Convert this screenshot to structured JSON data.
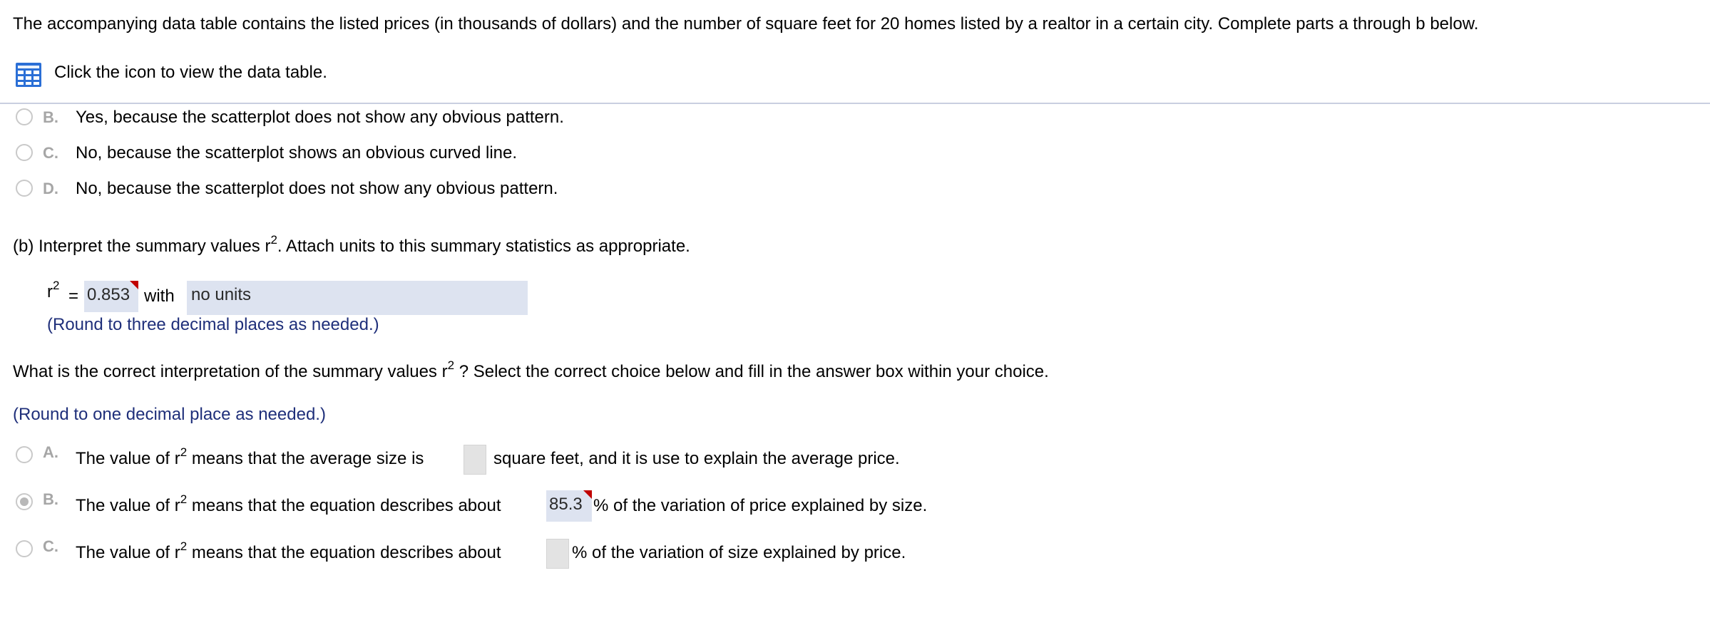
{
  "intro": "The accompanying data table contains the listed prices (in thousands of dollars) and the number of square feet for 20 homes listed by a realtor in a certain city. Complete parts a through b below.",
  "data_table_link": {
    "icon": "table-icon",
    "text": "Click the icon to view the data table."
  },
  "part_a_options": [
    {
      "letter": "B.",
      "text": "Yes, because the scatterplot does not show any obvious pattern."
    },
    {
      "letter": "C.",
      "text": "No, because the scatterplot shows an obvious curved line."
    },
    {
      "letter": "D.",
      "text": "No, because the scatterplot does not show any obvious pattern."
    }
  ],
  "part_b": {
    "prompt_pre": "(b) Interpret the summary values r",
    "prompt_exp": "2",
    "prompt_post": ". Attach units to this summary statistics as appropriate.",
    "r2_label": "r",
    "r2_exp": "2",
    "equals": "=",
    "r2_value": "0.853",
    "with_label": "with",
    "units_value": "no units",
    "round_hint": "(Round to three decimal places as needed.)"
  },
  "interpretation": {
    "question_pre": "What is the correct interpretation of the summary values r",
    "question_exp": "2",
    "question_post": " ? Select the correct choice below and fill in the answer box within your choice.",
    "round_hint": "(Round to one decimal place as needed.)",
    "options": [
      {
        "letter": "A.",
        "pre": "The value of r",
        "exp": "2",
        "mid": " means that the average size is",
        "value": "",
        "post": "square feet, and it is use to explain the average price.",
        "selected": false
      },
      {
        "letter": "B.",
        "pre": "The value of r",
        "exp": "2",
        "mid": " means that the equation describes about",
        "value": "85.3",
        "post": "% of the variation of price explained by size.",
        "selected": true
      },
      {
        "letter": "C.",
        "pre": "The value of r",
        "exp": "2",
        "mid": " means that the equation describes about",
        "value": "",
        "post": "% of the variation of size explained by price.",
        "selected": false
      }
    ]
  }
}
